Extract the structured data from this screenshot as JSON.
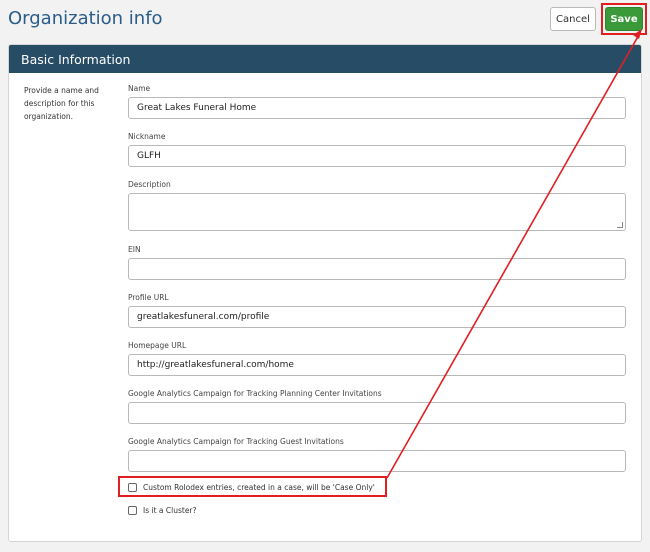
{
  "header": {
    "title": "Organization info",
    "cancel_label": "Cancel",
    "save_label": "Save"
  },
  "section": {
    "title": "Basic Information",
    "description": "Provide a name and description for this organization."
  },
  "fields": [
    {
      "label": "Name",
      "value": "Great Lakes Funeral Home"
    },
    {
      "label": "Nickname",
      "value": "GLFH"
    },
    {
      "label": "Description",
      "value": ""
    },
    {
      "label": "EIN",
      "value": ""
    },
    {
      "label": "Profile URL",
      "value": "greatlakesfuneral.com/profile"
    },
    {
      "label": "Homepage URL",
      "value": "http://greatlakesfuneral.com/home"
    },
    {
      "label": "Google Analytics Campaign for Tracking Planning Center Invitations",
      "value": ""
    },
    {
      "label": "Google Analytics Campaign for Tracking Guest Invitations",
      "value": ""
    }
  ],
  "checkboxes": [
    {
      "label": "Custom Rolodex entries, created in a case, will be 'Case Only'",
      "checked": false
    },
    {
      "label": "Is it a Cluster?",
      "checked": false
    }
  ],
  "annotation_color": "#e02020",
  "colors": {
    "header_bg": "#264c66",
    "title": "#2a5c8a",
    "save_bg": "#3a9a3a"
  }
}
